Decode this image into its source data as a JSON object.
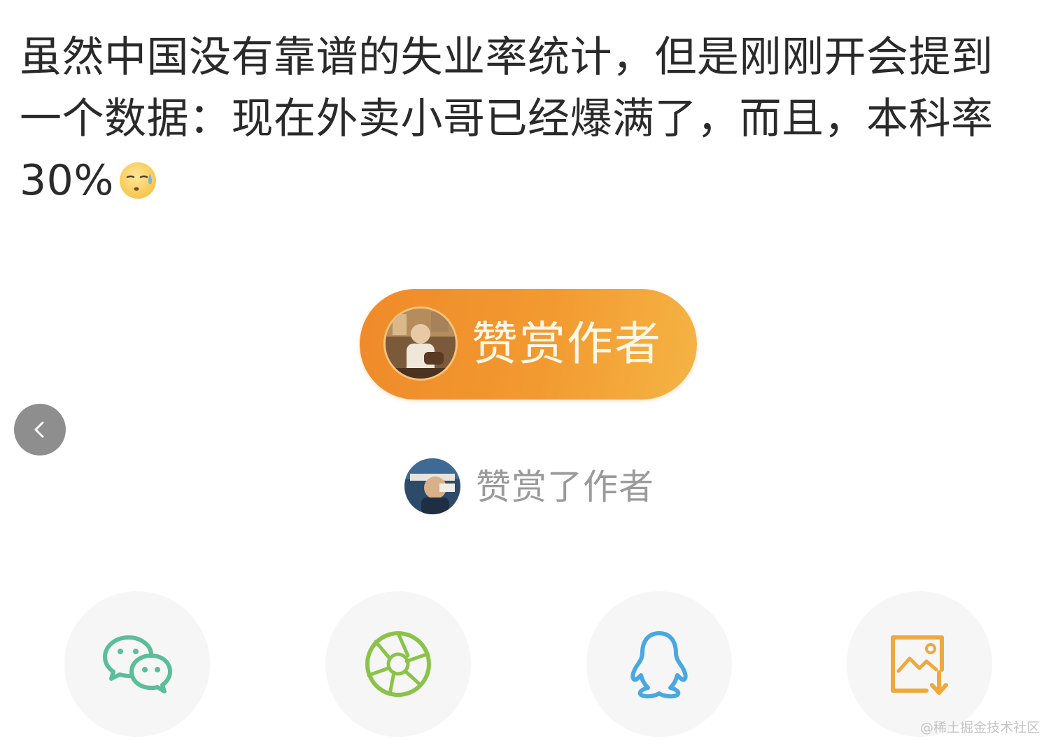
{
  "post": {
    "text": "虽然中国没有靠谱的失业率统计，但是刚刚开会提到一个数据：现在外卖小哥已经爆满了，而且，本科率30%",
    "emoji": "sweat-face-emoji"
  },
  "tip": {
    "button_label": "赞赏作者",
    "gradient_from": "#ef8a2a",
    "gradient_to": "#f5b445"
  },
  "tipped": {
    "label": "赞赏了作者"
  },
  "nav": {
    "back_icon": "chevron-left-icon"
  },
  "share": {
    "items": [
      {
        "icon": "wechat-icon",
        "color": "#5bbd9a"
      },
      {
        "icon": "moments-icon",
        "color": "#8bc34a"
      },
      {
        "icon": "qq-icon",
        "color": "#4aa8e0"
      },
      {
        "icon": "save-image-icon",
        "color": "#f0a83a"
      }
    ]
  },
  "watermark": "@稀土掘金技术社区"
}
